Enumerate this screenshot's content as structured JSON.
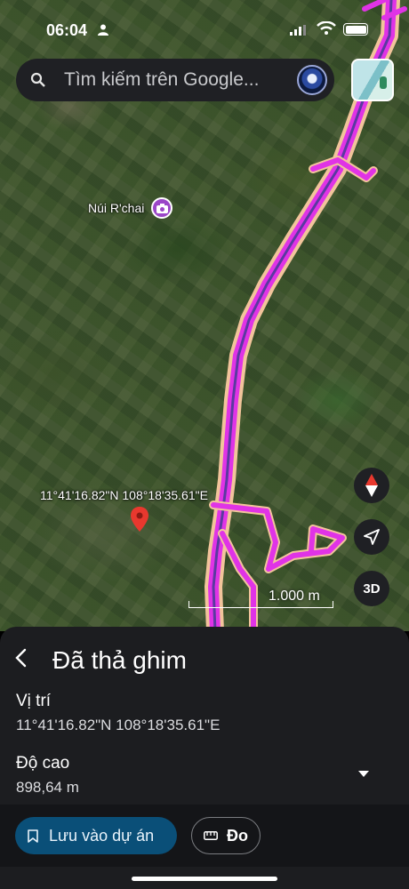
{
  "status_bar": {
    "time": "06:04"
  },
  "search": {
    "placeholder": "Tìm kiếm trên Google..."
  },
  "map": {
    "poi_label": "Núi R'chai",
    "pin_coordinates_label": "11°41'16.82\"N 108°18'35.61\"E",
    "scale_label": "1.000 m",
    "button_3d": "3D",
    "route_color": "#e033e6",
    "route_outline_color": "#f2c49b"
  },
  "sheet": {
    "title": "Đã thả ghim",
    "location_label": "Vị trí",
    "location_value": "11°41'16.82\"N 108°18'35.61\"E",
    "elevation_label": "Độ cao",
    "elevation_value": "898,64 m"
  },
  "actions": {
    "save_label": "Lưu vào dự án",
    "measure_label": "Đo"
  },
  "icons": [
    "person-icon",
    "signal-icon",
    "wifi-icon",
    "battery-icon",
    "search-icon",
    "avatar",
    "map-layers-icon",
    "camera-icon",
    "map-pin-icon",
    "compass-icon",
    "location-arrow-icon",
    "back-icon",
    "chevron-down-icon",
    "bookmark-icon",
    "ruler-icon"
  ],
  "colors": {
    "accent": "#0a4f78",
    "sheet_bg": "#1c1d20"
  }
}
